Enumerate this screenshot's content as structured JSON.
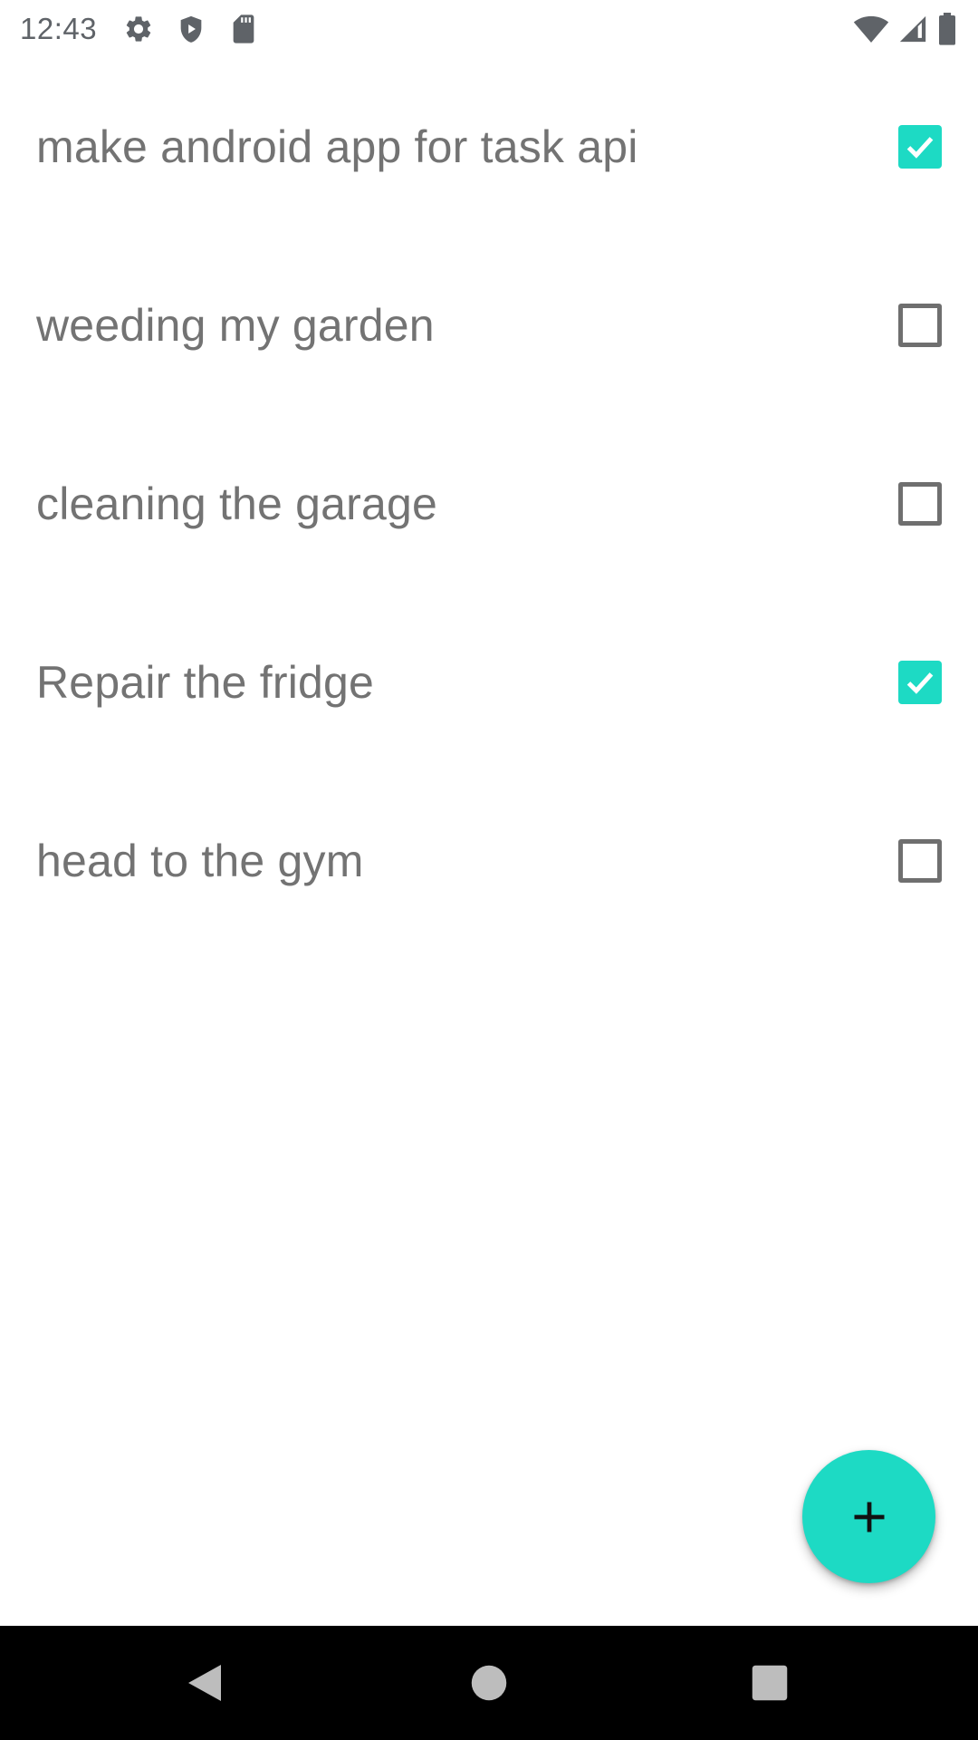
{
  "status_bar": {
    "time": "12:43",
    "icons_left": [
      "settings-icon",
      "shield-play-icon",
      "sd-card-icon"
    ],
    "icons_right": [
      "wifi-icon",
      "cell-signal-icon",
      "battery-icon"
    ]
  },
  "tasks": [
    {
      "label": "make android app for task api",
      "checked": true
    },
    {
      "label": "weeding my garden",
      "checked": false
    },
    {
      "label": "cleaning the garage",
      "checked": false
    },
    {
      "label": "Repair the fridge",
      "checked": true
    },
    {
      "label": "head to the gym",
      "checked": false
    }
  ],
  "fab": {
    "icon": "plus-icon"
  },
  "nav": {
    "buttons": [
      "back-icon",
      "home-icon",
      "recents-icon"
    ]
  },
  "colors": {
    "accent": "#1ddac4",
    "text": "#737373",
    "checkbox_border": "#6f6f6f",
    "status_icons": "#5f6368",
    "nav_bar": "#000000",
    "nav_icons": "#bdbdbd"
  }
}
